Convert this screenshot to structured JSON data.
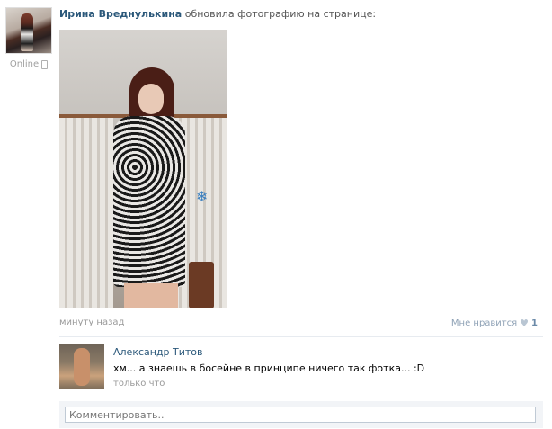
{
  "post": {
    "author_name": "Ирина Вреднулькина",
    "action_text": " обновила фотографию на странице:",
    "online_status": "Online",
    "time": "минуту назад",
    "like_label": "Мне нравится",
    "like_icon": "heart-icon",
    "like_count": "1"
  },
  "comment": {
    "author_name": "Александр Титов",
    "text": "хм... а знаешь в босейне в принципе ничего так фотка... :D",
    "time": "только что"
  },
  "reply": {
    "placeholder": "Комментировать.."
  },
  "colors": {
    "link": "#2b587a",
    "muted": "#999999",
    "divider": "#e7ebf0",
    "reply_bg": "#f2f4f7"
  }
}
